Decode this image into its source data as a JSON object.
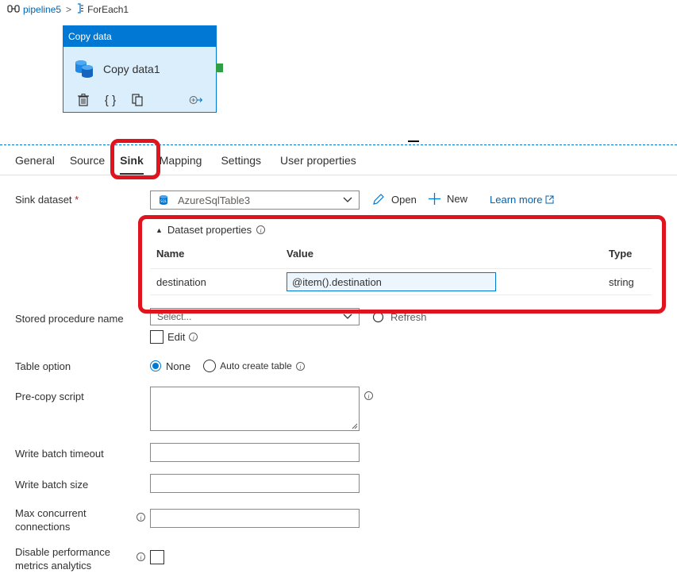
{
  "breadcrumb": {
    "pipeline": "pipeline5",
    "separator": ">",
    "foreach": "ForEach1"
  },
  "activity": {
    "header": "Copy data",
    "name": "Copy data1"
  },
  "tabs": [
    {
      "label": "General"
    },
    {
      "label": "Source"
    },
    {
      "label": "Sink"
    },
    {
      "label": "Mapping"
    },
    {
      "label": "Settings"
    },
    {
      "label": "User properties"
    }
  ],
  "sink": {
    "dataset_label": "Sink dataset",
    "required_mark": "*",
    "dataset_value": "AzureSqlTable3",
    "open_label": "Open",
    "new_label": "New",
    "learn_more_label": "Learn more",
    "dataset_properties_label": "Dataset properties",
    "properties_table": {
      "columns": [
        "Name",
        "Value",
        "Type"
      ],
      "rows": [
        {
          "name": "destination",
          "value": "@item().destination",
          "type": "string"
        }
      ]
    },
    "stored_procedure_label": "Stored procedure name",
    "stored_procedure_placeholder": "Select...",
    "refresh_label": "Refresh",
    "edit_label": "Edit",
    "table_option_label": "Table option",
    "table_option_none": "None",
    "table_option_auto": "Auto create table",
    "table_option_selected": "None",
    "precopy_label": "Pre-copy script",
    "write_batch_timeout_label": "Write batch timeout",
    "write_batch_size_label": "Write batch size",
    "max_concurrent_label_1": "Max concurrent",
    "max_concurrent_label_2": "connections",
    "disable_perf_label_1": "Disable performance",
    "disable_perf_label_2": "metrics analytics"
  },
  "colors": {
    "accent": "#0078d4",
    "highlight": "#e0141e",
    "activity_bg": "#dbeefc"
  }
}
